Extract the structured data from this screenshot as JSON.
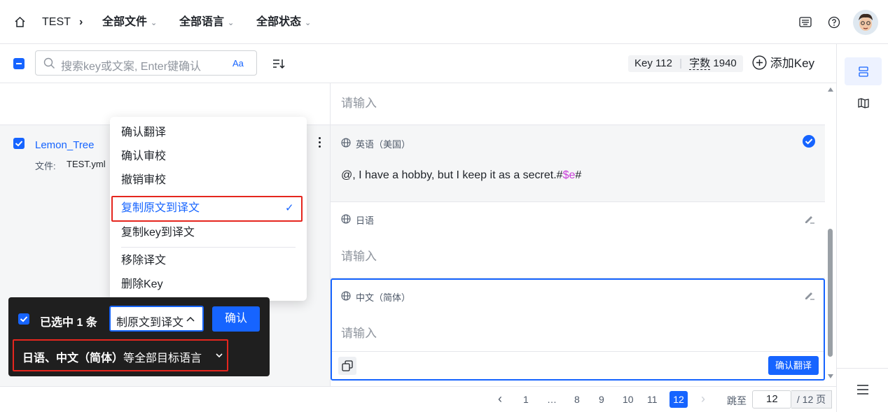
{
  "header": {
    "home_icon": "home-icon",
    "project": "TEST",
    "crumb_sep": "›",
    "filter_files": "全部文件",
    "filter_langs": "全部语言",
    "filter_status": "全部状态",
    "chevron": "⌄"
  },
  "toolbar": {
    "search_placeholder": "搜索key或文案, Enter键确认",
    "case_toggle": "Aa",
    "sort_icon": "sort-icon",
    "key_label": "Key",
    "key_count": "112",
    "char_label": "字数",
    "char_count": "1940",
    "add_key": "添加Key"
  },
  "entry": {
    "key_name": "Lemon_Tree",
    "file_label": "文件:",
    "file_name": "TEST.yml"
  },
  "menu": {
    "items": [
      "确认翻译",
      "确认审校",
      "撤销审校",
      "复制原文到译文",
      "复制key到译文",
      "移除译文",
      "删除Key"
    ],
    "selected": "复制原文到译文",
    "check": "✓"
  },
  "bulk": {
    "selected_text": "已选中 1 条",
    "action_value": "制原文到译文",
    "confirm": "确认",
    "target_prefix": "日语、中文（简体）",
    "target_suffix": "等全部目标语言"
  },
  "editor": {
    "top_placeholder": "请输入",
    "en_label": "英语（美国）",
    "en_text_a": "@, I have a hobby, but I keep it as a secret.#",
    "en_text_var": "$e",
    "en_text_b": "#",
    "ja_label": "日语",
    "ja_placeholder": "请输入",
    "zh_label": "中文（简体）",
    "zh_placeholder": "请输入",
    "confirm_translate": "确认翻译"
  },
  "pager": {
    "prev": "‹",
    "pages": [
      "1",
      "…",
      "8",
      "9",
      "10",
      "11",
      "12"
    ],
    "current": "12",
    "next": "›",
    "jump_label": "跳至",
    "jump_value": "12",
    "total": "/ 12 页"
  },
  "colors": {
    "accent": "#1664ff",
    "danger": "#e5261e",
    "var": "#c93fd9"
  }
}
